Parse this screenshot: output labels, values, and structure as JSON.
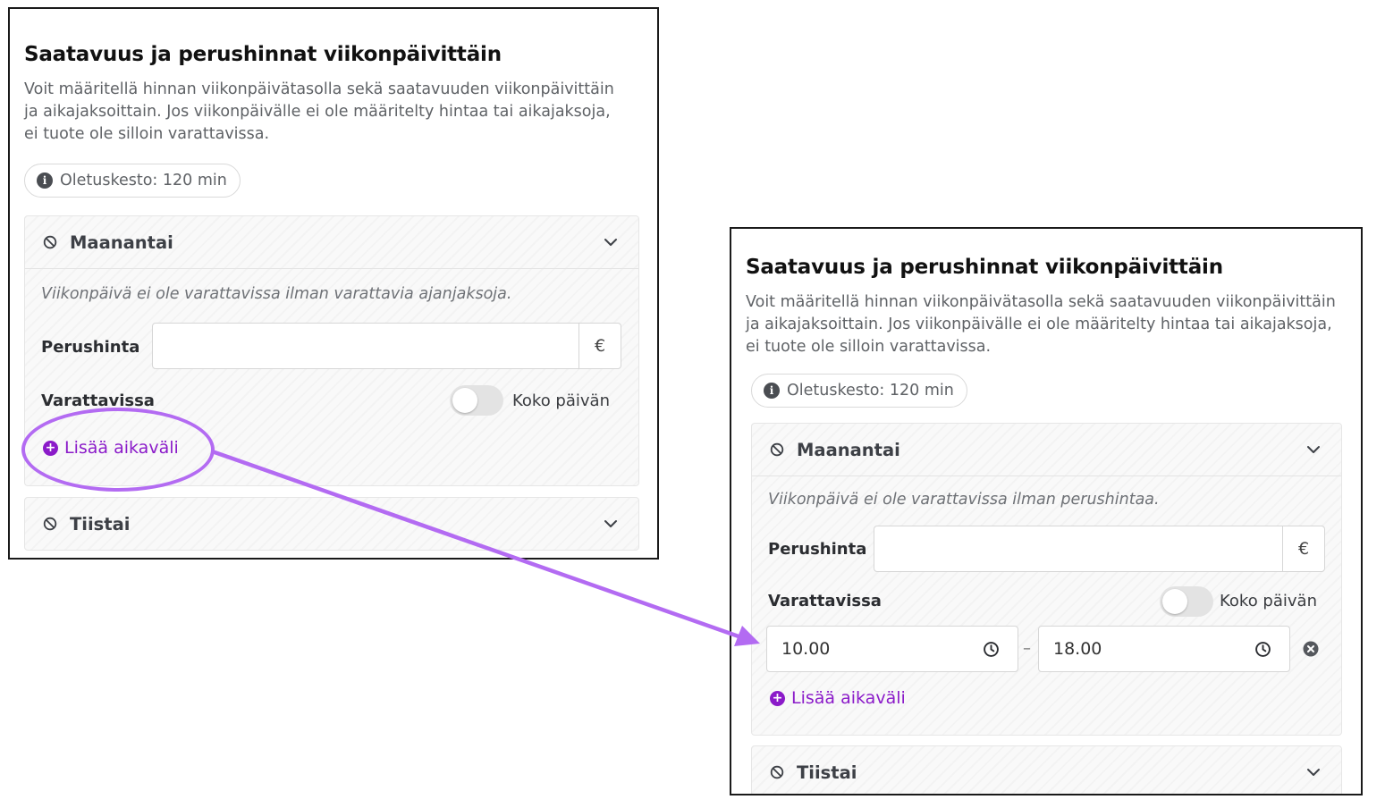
{
  "colors": {
    "accent": "#8b1bc9",
    "annotation": "#b36bf2",
    "muted_text": "#5f6266",
    "border": "#1a1a1a"
  },
  "panel_before": {
    "title": "Saatavuus ja perushinnat viikonpäivittäin",
    "description": "Voit määritellä hinnan viikonpäivätasolla sekä saatavuuden viikonpäivittäin ja aikajaksoittain. Jos viikonpäivälle ei ole määritelty hintaa tai aikajaksoja, ei tuote ole silloin varattavissa.",
    "default_duration_chip": "Oletuskesto: 120 min",
    "monday": {
      "name": "Maanantai",
      "note": "Viikonpäivä ei ole varattavissa ilman varattavia ajanjaksoja.",
      "base_price_label": "Perushinta",
      "base_price_value": "",
      "currency": "€",
      "bookable_label": "Varattavissa",
      "all_day_label": "Koko päivän",
      "all_day_on": false,
      "add_interval_label": "Lisää aikaväli"
    },
    "tuesday": {
      "name": "Tiistai"
    }
  },
  "panel_after": {
    "title": "Saatavuus ja perushinnat viikonpäivittäin",
    "description": "Voit määritellä hinnan viikonpäivätasolla sekä saatavuuden viikonpäivittäin ja aikajaksoittain. Jos viikonpäivälle ei ole määritelty hintaa tai aikajaksoja, ei tuote ole silloin varattavissa.",
    "default_duration_chip": "Oletuskesto: 120 min",
    "monday": {
      "name": "Maanantai",
      "note": "Viikonpäivä ei ole varattavissa ilman perushintaa.",
      "base_price_label": "Perushinta",
      "base_price_value": "",
      "currency": "€",
      "bookable_label": "Varattavissa",
      "all_day_label": "Koko päivän",
      "all_day_on": false,
      "interval": {
        "start": "10.00",
        "separator": "–",
        "end": "18.00"
      },
      "add_interval_label": "Lisää aikaväli"
    },
    "tuesday": {
      "name": "Tiistai"
    }
  },
  "icons": {
    "info": "info-icon",
    "unavailable": "ban-icon",
    "expand": "chevron-down-icon",
    "add": "plus-circle-icon",
    "time": "clock-icon",
    "remove": "close-circle-icon"
  }
}
